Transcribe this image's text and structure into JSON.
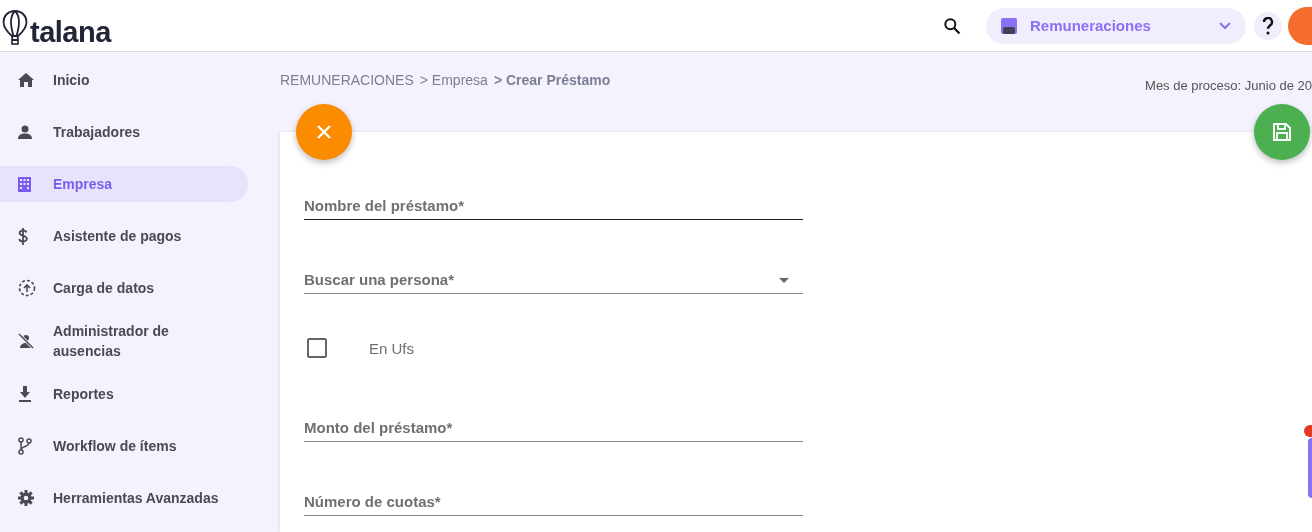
{
  "header": {
    "logo": "talana",
    "module": "Remuneraciones"
  },
  "sidebar": {
    "items": [
      {
        "label": "Inicio",
        "kind": "home",
        "selected": false
      },
      {
        "label": "Trabajadores",
        "kind": "person",
        "selected": false
      },
      {
        "label": "Empresa",
        "kind": "building",
        "selected": true
      },
      {
        "label": "Asistente de pagos",
        "kind": "dollar",
        "selected": false
      },
      {
        "label": "Carga de datos",
        "kind": "upload",
        "selected": false
      },
      {
        "label": "Administrador de ausencias",
        "kind": "person-off",
        "selected": false
      },
      {
        "label": "Reportes",
        "kind": "download",
        "selected": false
      },
      {
        "label": "Workflow de ítems",
        "kind": "branch",
        "selected": false
      },
      {
        "label": "Herramientas Avanzadas",
        "kind": "gear",
        "selected": false
      }
    ]
  },
  "breadcrumbs": [
    {
      "label": "REMUNERACIONES",
      "current": false
    },
    {
      "label": "> Empresa",
      "current": false
    },
    {
      "label": "> Crear Préstamo",
      "current": true
    }
  ],
  "process_month": "Mes de proceso: Junio de 20",
  "form": {
    "fields": [
      {
        "kind": "text",
        "placeholder": "Nombre del préstamo*",
        "focused": true
      },
      {
        "kind": "select",
        "placeholder": "Buscar una persona*",
        "focused": false
      },
      {
        "kind": "checkbox",
        "label": "En Ufs",
        "checked": false
      },
      {
        "kind": "text",
        "placeholder": "Monto del préstamo*",
        "focused": false
      },
      {
        "kind": "text",
        "placeholder": "Número de cuotas*",
        "focused": false
      }
    ]
  }
}
